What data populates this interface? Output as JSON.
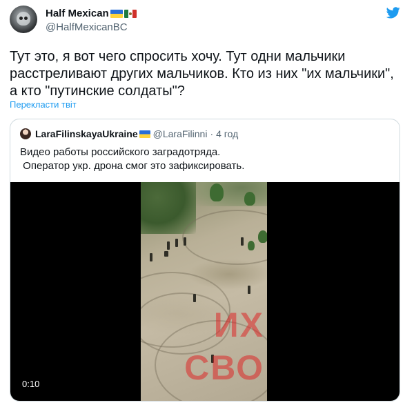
{
  "author": {
    "name": "Half Mexican",
    "handle": "@HalfMexicanBC"
  },
  "tweet": {
    "text": "Тут это, я вот чего спросить хочу. Тут одни мальчики расстреливают других мальчиков. Кто из них \"их мальчики\", а кто \"путинские солдаты\"?",
    "translate_label": "Перекласти твіт"
  },
  "quote": {
    "author_name": "LaraFilinskayaUkraine",
    "handle": "@LaraFilinni",
    "separator": "·",
    "time": "4 год",
    "text": "Видео работы российского заградотряда.\n Оператор укр. дрона смог это зафиксировать."
  },
  "video": {
    "timestamp": "0:10",
    "overlay_line1": "ИХ",
    "overlay_line2": "СВО"
  },
  "colors": {
    "accent": "#1d9bf0",
    "text": "#0f1419",
    "secondary_text": "#536471",
    "border": "#cfd9de"
  },
  "icons": [
    "twitter-bird-icon",
    "ukraine-flag-icon",
    "mexico-flag-icon"
  ]
}
